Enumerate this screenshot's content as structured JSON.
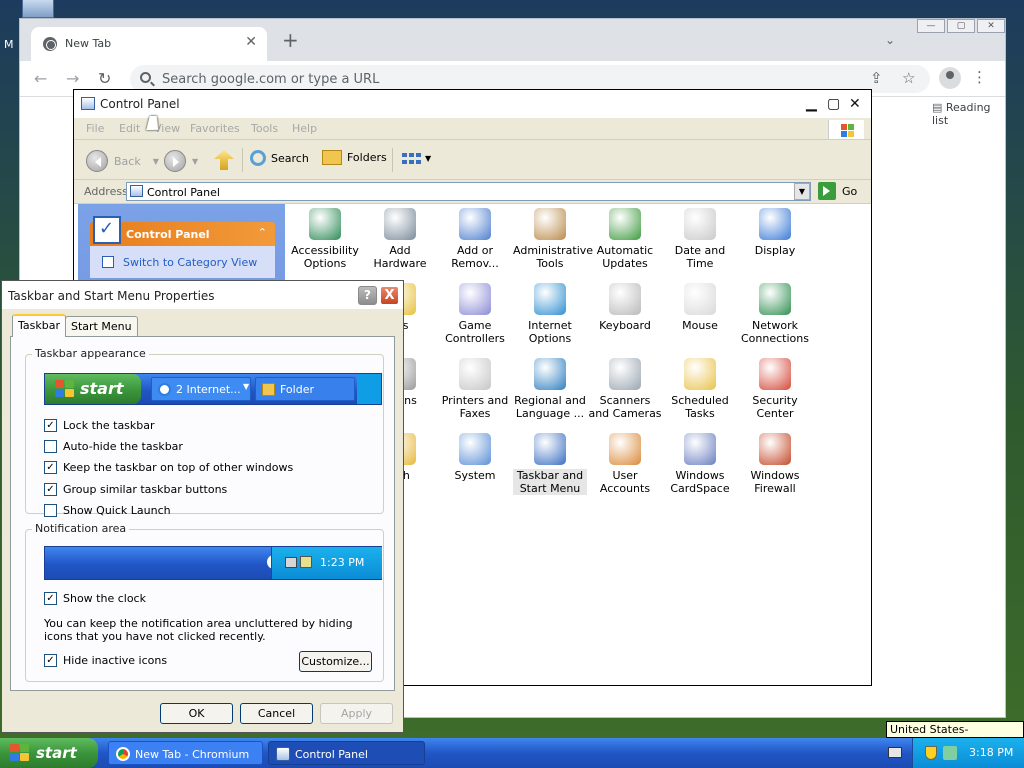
{
  "desktop": {
    "icon_label": "M"
  },
  "browser": {
    "tab_title": "New Tab",
    "omnibox_placeholder": "Search google.com or type a URL",
    "reading_list": "Reading list"
  },
  "control_panel": {
    "title": "Control Panel",
    "menu": [
      "File",
      "Edit",
      "View",
      "Favorites",
      "Tools",
      "Help"
    ],
    "toolbar": {
      "back": "Back",
      "search": "Search",
      "folders": "Folders"
    },
    "address_label": "Address",
    "address_value": "Control Panel",
    "go": "Go",
    "side_panel": {
      "title": "Control Panel",
      "switch_link": "Switch to Category View"
    },
    "items": [
      {
        "label": "Accessibility Options",
        "icon": "accessibility-icon",
        "color": "#2e8b57"
      },
      {
        "label": "Add Hardware",
        "icon": "add-hardware-icon",
        "color": "#7a8a9a"
      },
      {
        "label": "Add or Remov...",
        "icon": "add-remove-icon",
        "color": "#4f7fcf"
      },
      {
        "label": "Administrative Tools",
        "icon": "admin-tools-icon",
        "color": "#b98b4b"
      },
      {
        "label": "Automatic Updates",
        "icon": "windows-update-icon",
        "color": "#3f9a3f"
      },
      {
        "label": "Date and Time",
        "icon": "clock-icon",
        "color": "#c9c9c9"
      },
      {
        "label": "Display",
        "icon": "display-icon",
        "color": "#3b7ad6"
      },
      {
        "label": "nts",
        "icon": "fonts-icon",
        "color": "#e6c13c"
      },
      {
        "label": "Game Controllers",
        "icon": "gamepad-icon",
        "color": "#8b8bd6"
      },
      {
        "label": "Internet Options",
        "icon": "globe-icon",
        "color": "#2f8fd0"
      },
      {
        "label": "Keyboard",
        "icon": "keyboard-icon",
        "color": "#b9b9b9"
      },
      {
        "label": "Mouse",
        "icon": "mouse-icon",
        "color": "#d9d9d9"
      },
      {
        "label": "Network Connections",
        "icon": "network-globe-icon",
        "color": "#2f8f4f"
      },
      {
        "label": "ptions",
        "icon": "phone-icon",
        "color": "#9a9a9a"
      },
      {
        "label": "Printers and Faxes",
        "icon": "printer-icon",
        "color": "#c6c6c6"
      },
      {
        "label": "Regional and Language ...",
        "icon": "globe-icon",
        "color": "#2f7fc0"
      },
      {
        "label": "Scanners and Cameras",
        "icon": "scanner-icon",
        "color": "#9aa6b2"
      },
      {
        "label": "Scheduled Tasks",
        "icon": "scheduled-tasks-icon",
        "color": "#e9c24a"
      },
      {
        "label": "Security Center",
        "icon": "shield-icon",
        "color": "#d44a3a"
      },
      {
        "label": "ech",
        "icon": "speech-icon",
        "color": "#e6b83c"
      },
      {
        "label": "System",
        "icon": "system-icon",
        "color": "#5a8fd6"
      },
      {
        "label": "Taskbar and Start Menu",
        "icon": "taskbar-icon",
        "color": "#3a6fc0"
      },
      {
        "label": "User Accounts",
        "icon": "users-icon",
        "color": "#d98a3a"
      },
      {
        "label": "Windows CardSpace",
        "icon": "cardspace-icon",
        "color": "#6a7fc0"
      },
      {
        "label": "Windows Firewall",
        "icon": "firewall-icon",
        "color": "#c44a2a"
      }
    ]
  },
  "dialog": {
    "title": "Taskbar and Start Menu Properties",
    "help": "?",
    "close": "X",
    "tabs": [
      "Taskbar",
      "Start Menu"
    ],
    "appearance_group": "Taskbar appearance",
    "preview": {
      "start": "start",
      "btn1": "2 Internet...",
      "btn2": "Folder"
    },
    "options": [
      {
        "label": "Lock the taskbar",
        "checked": true
      },
      {
        "label": "Auto-hide the taskbar",
        "checked": false
      },
      {
        "label": "Keep the taskbar on top of other windows",
        "checked": true
      },
      {
        "label": "Group similar taskbar buttons",
        "checked": true
      },
      {
        "label": "Show Quick Launch",
        "checked": false
      }
    ],
    "notification_group": "Notification area",
    "tray_time": "1:23 PM",
    "show_clock": "Show the clock",
    "description": "You can keep the notification area uncluttered by hiding icons that you have not clicked recently.",
    "hide_inactive": "Hide inactive icons",
    "customize": "Customize...",
    "ok": "OK",
    "cancel": "Cancel",
    "apply": "Apply"
  },
  "taskbar": {
    "start": "start",
    "tasks": [
      {
        "label": "New Tab - Chromium",
        "active": false
      },
      {
        "label": "Control Panel",
        "active": true
      }
    ],
    "time": "3:18 PM",
    "tooltip": "United States-International"
  },
  "colors": {
    "xp_blue": "#2156c6",
    "start_green": "#3b963b",
    "close_red": "#c7451f"
  }
}
